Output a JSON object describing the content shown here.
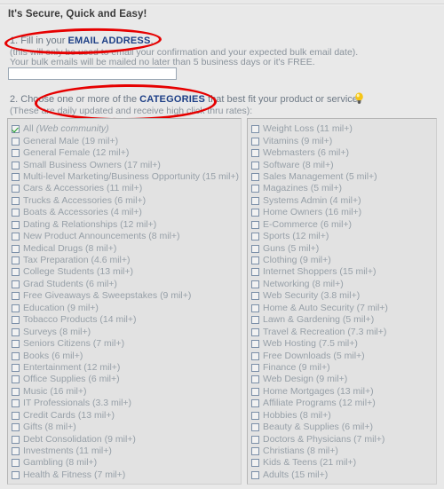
{
  "header": {
    "title": "It's Secure, Quick and Easy!"
  },
  "step1": {
    "number": "1.",
    "text_before": " Fill in your ",
    "emphasis": "EMAIL ADDRESS",
    "text_after": ".",
    "note_line1": "(this will only be used to email your confirmation and your expected bulk email date).",
    "note_line2": "Your bulk emails will be mailed no later than 5 business days or it's FREE.",
    "email_value": "",
    "email_placeholder": ""
  },
  "step2": {
    "number": "2.",
    "text_before": " Choose one or more of the ",
    "emphasis": "CATEGORIES",
    "text_after": " that best fit your product or service.",
    "note_line1": "(These are daily updated and receive high click thru rates):",
    "hint_icon": "lightbulb-icon"
  },
  "colors": {
    "page_bg": "#e9e9e9",
    "panel_bg": "#e2e2e2",
    "marker_red": "#e60000",
    "emphasis_blue": "#1d3f86",
    "label_gray": "#97a0a8",
    "check_green": "#1a9e24",
    "bulb_yellow": "#f5c518"
  },
  "categories": {
    "left": [
      {
        "label": "All (Web community)",
        "italic_part": "(Web community)",
        "plain_part": "All ",
        "checked": true
      },
      {
        "label": "General Male (19 mil+)",
        "checked": false
      },
      {
        "label": "General Female (12 mil+)",
        "checked": false
      },
      {
        "label": "Small Business Owners (17 mil+)",
        "checked": false
      },
      {
        "label": "Multi-level Marketing/Business Opportunity (15 mil+)",
        "checked": false
      },
      {
        "label": "Cars & Accessories (11 mil+)",
        "checked": false
      },
      {
        "label": "Trucks & Accessories (6 mil+)",
        "checked": false
      },
      {
        "label": "Boats & Accessories (4 mil+)",
        "checked": false
      },
      {
        "label": "Dating & Relationships (12 mil+)",
        "checked": false
      },
      {
        "label": "New Product Announcements (8 mil+)",
        "checked": false
      },
      {
        "label": "Medical Drugs (8 mil+)",
        "checked": false
      },
      {
        "label": "Tax Preparation (4.6 mil+)",
        "checked": false
      },
      {
        "label": "College Students (13 mil+)",
        "checked": false
      },
      {
        "label": "Grad Students (6 mil+)",
        "checked": false
      },
      {
        "label": "Free Giveaways & Sweepstakes (9 mil+)",
        "checked": false
      },
      {
        "label": "Education (9 mil+)",
        "checked": false
      },
      {
        "label": "Tobacco Products (14 mil+)",
        "checked": false
      },
      {
        "label": "Surveys (8 mil+)",
        "checked": false
      },
      {
        "label": "Seniors Citizens (7 mil+)",
        "checked": false
      },
      {
        "label": "Books (6 mil+)",
        "checked": false
      },
      {
        "label": "Entertainment (12 mil+)",
        "checked": false
      },
      {
        "label": "Office Supplies (6 mil+)",
        "checked": false
      },
      {
        "label": "Music (16 mil+)",
        "checked": false
      },
      {
        "label": "IT Professionals (3.3 mil+)",
        "checked": false
      },
      {
        "label": "Credit Cards (13 mil+)",
        "checked": false
      },
      {
        "label": "Gifts (8 mil+)",
        "checked": false
      },
      {
        "label": "Debt Consolidation (9 mil+)",
        "checked": false
      },
      {
        "label": "Investments (11 mil+)",
        "checked": false
      },
      {
        "label": "Gambling (8 mil+)",
        "checked": false
      },
      {
        "label": "Health & Fitness (7 mil+)",
        "checked": false
      }
    ],
    "right": [
      {
        "label": "Weight Loss (11 mil+)",
        "checked": false
      },
      {
        "label": "Vitamins (9 mil+)",
        "checked": false
      },
      {
        "label": "Webmasters (6 mil+)",
        "checked": false
      },
      {
        "label": "Software (8 mil+)",
        "checked": false
      },
      {
        "label": "Sales Management (5 mil+)",
        "checked": false
      },
      {
        "label": "Magazines (5 mil+)",
        "checked": false
      },
      {
        "label": "Systems Admin (4 mil+)",
        "checked": false
      },
      {
        "label": "Home Owners (16 mil+)",
        "checked": false
      },
      {
        "label": "E-Commerce (6 mil+)",
        "checked": false
      },
      {
        "label": "Sports (12 mil+)",
        "checked": false
      },
      {
        "label": "Guns (5 mil+)",
        "checked": false
      },
      {
        "label": "Clothing (9 mil+)",
        "checked": false
      },
      {
        "label": "Internet Shoppers (15 mil+)",
        "checked": false
      },
      {
        "label": "Networking (8 mil+)",
        "checked": false
      },
      {
        "label": "Web Security (3.8 mil+)",
        "checked": false
      },
      {
        "label": "Home & Auto Security (7 mil+)",
        "checked": false
      },
      {
        "label": "Lawn & Gardening (5 mil+)",
        "checked": false
      },
      {
        "label": "Travel & Recreation (7.3 mil+)",
        "checked": false
      },
      {
        "label": "Web Hosting (7.5 mil+)",
        "checked": false
      },
      {
        "label": "Free Downloads (5 mil+)",
        "checked": false
      },
      {
        "label": "Finance (9 mil+)",
        "checked": false
      },
      {
        "label": "Web Design (9 mil+)",
        "checked": false
      },
      {
        "label": "Home Mortgages (13 mil+)",
        "checked": false
      },
      {
        "label": "Affiliate Programs (12 mil+)",
        "checked": false
      },
      {
        "label": "Hobbies (8 mil+)",
        "checked": false
      },
      {
        "label": "Beauty & Supplies (6 mil+)",
        "checked": false
      },
      {
        "label": "Doctors & Physicians (7 mil+)",
        "checked": false
      },
      {
        "label": "Christians (8 mil+)",
        "checked": false
      },
      {
        "label": "Kids & Teens (21 mil+)",
        "checked": false
      },
      {
        "label": "Adults (15 mil+)",
        "checked": false
      }
    ]
  }
}
